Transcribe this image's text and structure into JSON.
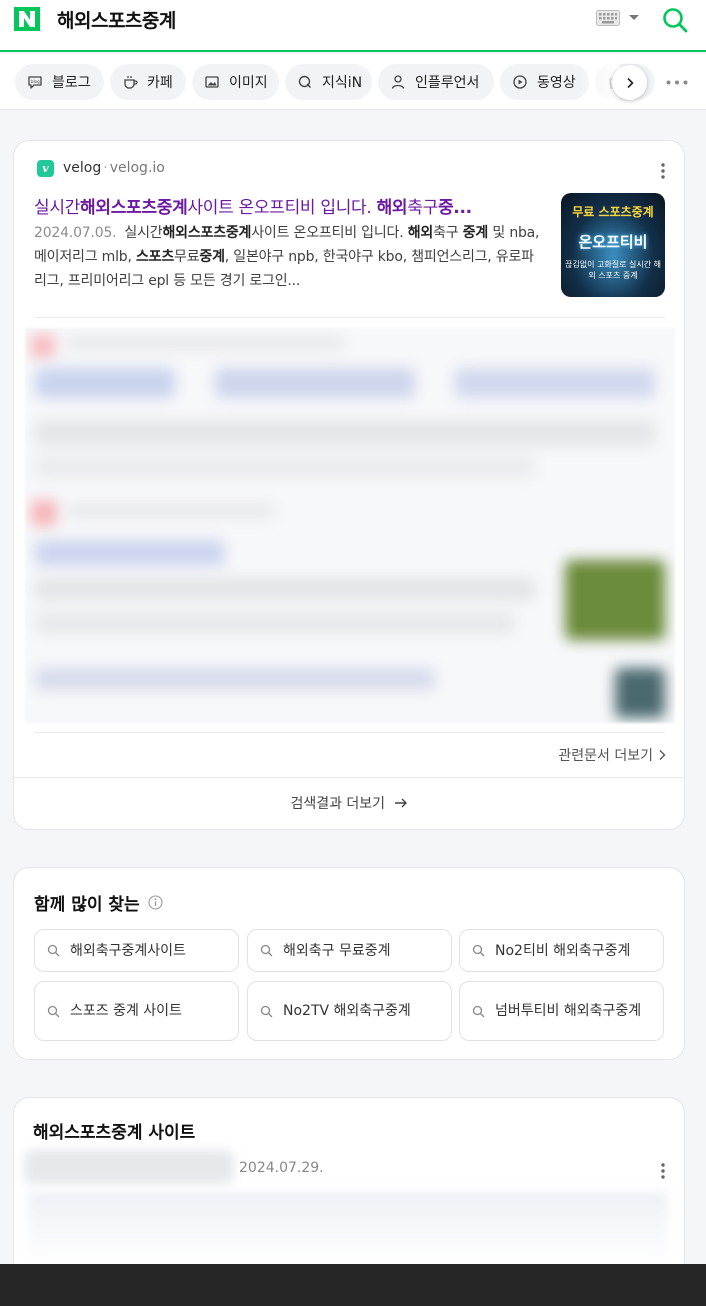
{
  "header": {
    "logo": "N",
    "query": "해외스포츠중계",
    "icons": {
      "keyboard": "keyboard-icon",
      "dropdown": "chevron-down-icon",
      "search": "search-icon"
    }
  },
  "tabs": [
    {
      "label": "블로그",
      "icon": "blog-icon"
    },
    {
      "label": "카페",
      "icon": "cafe-icon"
    },
    {
      "label": "이미지",
      "icon": "image-icon"
    },
    {
      "label": "지식iN",
      "icon": "knowledge-icon"
    },
    {
      "label": "인플루언서",
      "icon": "person-icon"
    },
    {
      "label": "동영상",
      "icon": "play-icon"
    }
  ],
  "result": {
    "favicon": "v",
    "site_name": "velog",
    "separator": "·",
    "domain": "velog.io",
    "title_plain_1": "실시간",
    "title_bold_1": "해외스포츠중계",
    "title_plain_2": "사이트 온오프티비 입니다.",
    "title_bold_2": "해외",
    "title_plain_3": "축구",
    "title_bold_3": "중...",
    "date": "2024.07.05.",
    "snippet_plain_1": "실시간",
    "snippet_bold_1": "해외스포츠중계",
    "snippet_plain_2": "사이트 온오프티비 입니다.",
    "snippet_bold_2": "해외",
    "snippet_plain_3": "축구",
    "snippet_bold_3": "중계",
    "snippet_plain_4": "및 nba, 메이저리그 mlb,",
    "snippet_bold_4": "스포츠",
    "snippet_plain_5": "무료",
    "snippet_bold_5": "중계",
    "snippet_plain_6": ", 일본야구 npb, 한국야구 kbo, 챔피언스리그, 유로파리그, 프리미어리그 epl 등 모든 경기 로그인...",
    "thumbnail": {
      "line1": "무료 스포츠중계",
      "line2": "온오프티비",
      "line3": "끊김없이 고화질로 실시간 해외 스포츠 중계"
    },
    "related_link": "관련문서 더보기",
    "more_results": "검색결과 더보기"
  },
  "related_searches": {
    "heading": "함께 많이 찾는",
    "items": [
      "해외축구중계사이트",
      "해외축구 무료중계",
      "No2티비 해외축구중계",
      "스포즈 중계 사이트",
      "No2TV 해외축구중계",
      "넘버투티비 해외축구중계"
    ]
  },
  "section": {
    "title": "해외스포츠중계 사이트",
    "date": "2024.07.29."
  },
  "colors": {
    "brand": "#03c75a",
    "visited_link": "#6b1aa3"
  }
}
